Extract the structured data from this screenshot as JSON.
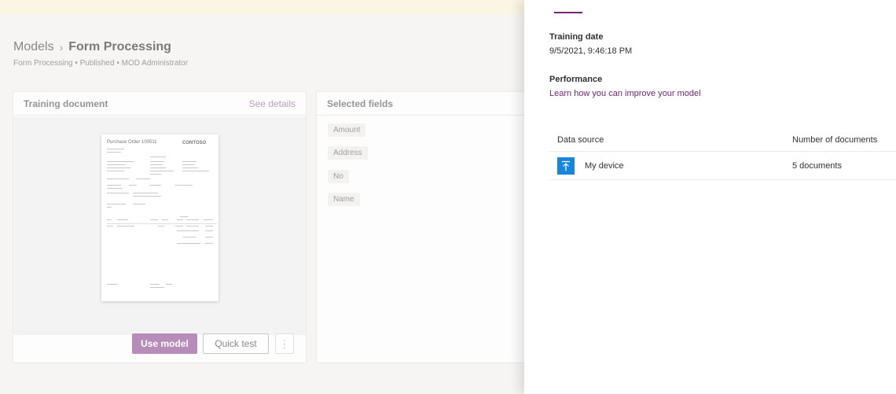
{
  "breadcrumb": {
    "root": "Models",
    "separator": "›",
    "current": "Form Processing"
  },
  "subtitle": "Form Processing • Published • MOD Administrator",
  "training_card": {
    "title": "Training document",
    "see_details": "See details",
    "document": {
      "heading": "Purchase Order 100511",
      "logo_text": "CONTOSO"
    },
    "use_model_label": "Use model",
    "quick_test_label": "Quick test",
    "more_label": "⋮"
  },
  "fields_card": {
    "title": "Selected fields",
    "fields": [
      "Amount",
      "Address",
      "No",
      "Name"
    ]
  },
  "panel": {
    "training_date_label": "Training date",
    "training_date_value": "9/5/2021, 9:46:18 PM",
    "performance_label": "Performance",
    "performance_link": "Learn how you can improve your model",
    "table": {
      "col_source": "Data source",
      "col_docs": "Number of documents",
      "rows": [
        {
          "source": "My device",
          "count": "5 documents",
          "icon": "upload-icon"
        }
      ]
    }
  },
  "colors": {
    "accent": "#742774",
    "primary_button": "#b88cb9",
    "upload_icon_bg": "#1a86d9"
  }
}
